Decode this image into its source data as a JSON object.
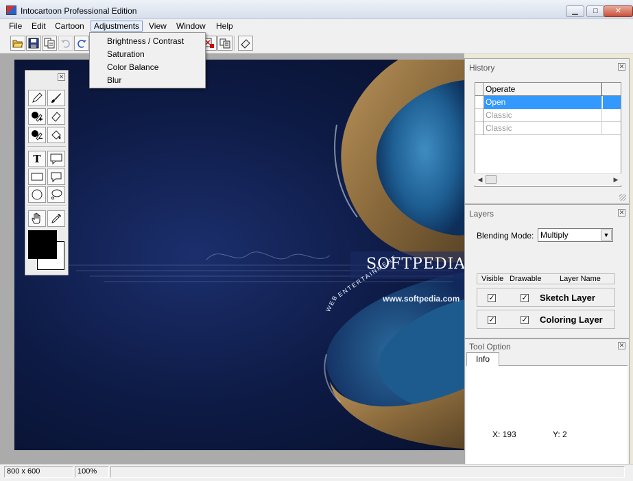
{
  "window": {
    "title": "Intocartoon Professional Edition",
    "min": "▁",
    "max": "□",
    "close": "✕"
  },
  "menu": [
    "File",
    "Edit",
    "Cartoon",
    "Adjustments",
    "View",
    "Window",
    "Help"
  ],
  "adjustments_menu": [
    "Brightness / Contrast",
    "Saturation",
    "Color Balance",
    "Blur"
  ],
  "toolbar_icons": [
    "open-icon",
    "save-icon",
    "copy-icon",
    "undo-icon",
    "redo-icon",
    "cartoon-effect-icon",
    "batch-icon",
    "eraser-icon"
  ],
  "canvas": {
    "brand": "SOFTPEDIA",
    "url": "www.softpedia.com",
    "web": "WEB",
    "ent": "ENTERTAINMENT"
  },
  "palette": {
    "close": "✕",
    "tools": [
      "pencil-icon",
      "brush-icon",
      "add-shade-icon",
      "eraser-icon",
      "remove-shade-icon",
      "fill-icon",
      "text-tool",
      "speech-bubble-icon",
      "rectangle-icon",
      "callout-icon",
      "ellipse-icon",
      "thought-bubble-icon",
      "hand-icon",
      "eyedropper-icon"
    ],
    "text_tool_label": "T",
    "foreground": "#000000",
    "background": "#ffffff"
  },
  "history": {
    "title": "History",
    "column": "Operate",
    "rows": [
      "Open",
      "Classic",
      "Classic"
    ],
    "selected": 0
  },
  "layers": {
    "title": "Layers",
    "blend_label": "Blending Mode:",
    "blend_value": "Multiply",
    "headers": {
      "visible": "Visible",
      "drawable": "Drawable",
      "name": "Layer Name"
    },
    "items": [
      {
        "name": "Sketch Layer",
        "visible": true,
        "drawable": true
      },
      {
        "name": "Coloring Layer",
        "visible": true,
        "drawable": true
      }
    ]
  },
  "tool_option": {
    "title": "Tool Option",
    "tab": "Info",
    "x": "X: 193",
    "y": "Y: 2"
  },
  "status": {
    "size": "800 x 600",
    "zoom": "100%"
  },
  "colors": {
    "selection": "#3399ff",
    "canvas_deep": "#0d1a44"
  }
}
